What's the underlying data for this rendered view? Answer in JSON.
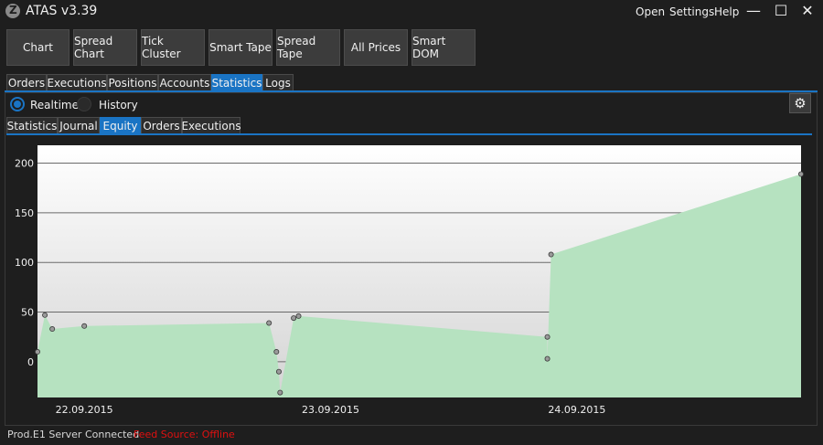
{
  "app": {
    "title": "ATAS v3.39",
    "logo_letter": "Z",
    "menu": [
      "Open",
      "Settings",
      "Help"
    ],
    "window_controls": {
      "minimize": "—",
      "maximize": "☐",
      "close": "✕"
    }
  },
  "toolbar": [
    "Chart",
    "Spread Chart",
    "Tick Cluster",
    "Smart Tape",
    "Spread Tape",
    "All Prices",
    "Smart DOM"
  ],
  "main_tabs": {
    "items": [
      "Orders",
      "Executions",
      "Positions",
      "Accounts",
      "Statistics",
      "Logs"
    ],
    "active": "Statistics"
  },
  "mode": {
    "options": [
      "Realtime",
      "History"
    ],
    "selected": "Realtime"
  },
  "settings_icon": "gear-icon",
  "sub_tabs": {
    "items": [
      "Statistics",
      "Journal",
      "Equity",
      "Orders",
      "Executions"
    ],
    "active": "Equity"
  },
  "chart_data": {
    "type": "area",
    "yticks": [
      0,
      50,
      100,
      150,
      200
    ],
    "ylim": [
      -36,
      218
    ],
    "xticks": [
      "22.09.2015",
      "23.09.2015",
      "24.09.2015"
    ],
    "grid": true,
    "fill_color": "#b6e2c0",
    "points": [
      {
        "x": 0.0,
        "y": 10
      },
      {
        "x": 0.3,
        "y": 47
      },
      {
        "x": 0.6,
        "y": 33
      },
      {
        "x": 1.9,
        "y": 36
      },
      {
        "x": 9.4,
        "y": 39
      },
      {
        "x": 9.7,
        "y": 10
      },
      {
        "x": 9.8,
        "y": -10
      },
      {
        "x": 9.85,
        "y": -31
      },
      {
        "x": 10.4,
        "y": 44
      },
      {
        "x": 10.6,
        "y": 46
      },
      {
        "x": 20.7,
        "y": 25
      },
      {
        "x": 20.7,
        "y": 3
      },
      {
        "x": 20.85,
        "y": 108
      },
      {
        "x": 31.0,
        "y": 189
      }
    ],
    "x_tick_positions": [
      1.9,
      11.9,
      21.9
    ],
    "xlim": [
      0,
      31
    ]
  },
  "status": {
    "server": "Prod.E1 Server Connected",
    "feed": "Feed Source: Offline",
    "feed_color": "#e01010"
  }
}
